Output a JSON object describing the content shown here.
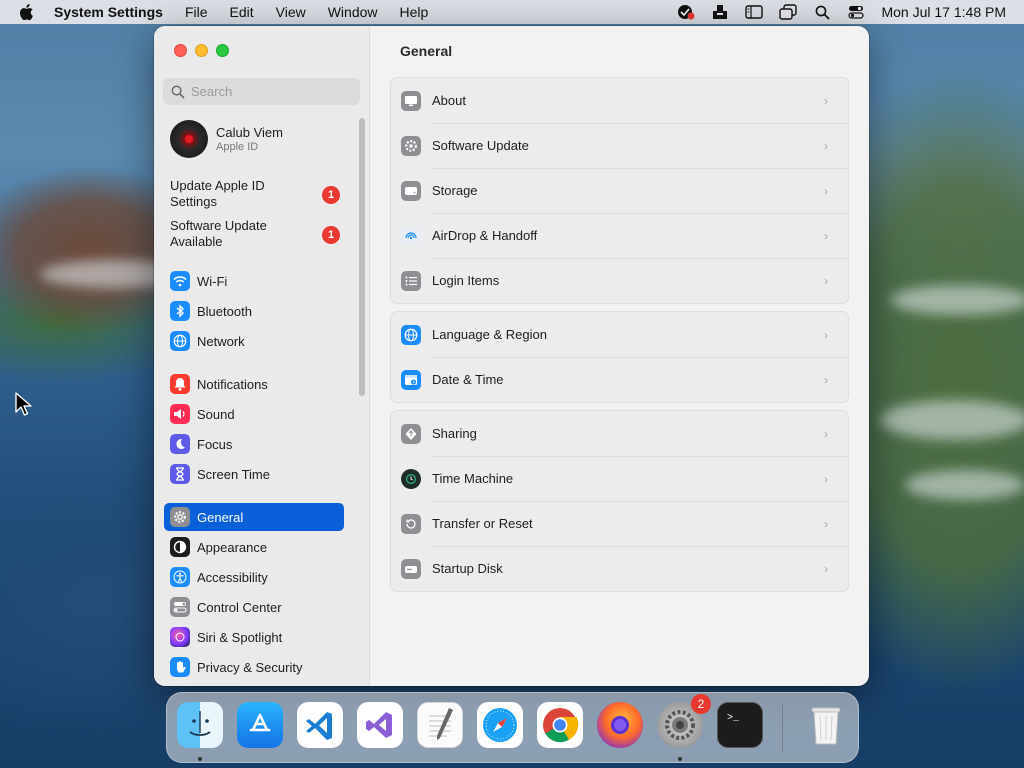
{
  "menubar": {
    "app_name": "System Settings",
    "menus": [
      "File",
      "Edit",
      "View",
      "Window",
      "Help"
    ],
    "status_icons": [
      "security-icon",
      "inbox-tray-icon",
      "sidebar-list-icon",
      "window-stack-icon",
      "search-icon",
      "control-center-icon"
    ],
    "clock": "Mon Jul 17  1:48 PM"
  },
  "window": {
    "sidebar": {
      "search_placeholder": "Search",
      "account": {
        "name": "Calub Viem",
        "subtitle": "Apple ID"
      },
      "notices": [
        {
          "label": "Update Apple ID Settings",
          "badge": "1"
        },
        {
          "label": "Software Update Available",
          "badge": "1"
        }
      ],
      "items": [
        {
          "label": "Wi-Fi",
          "icon": "wifi-icon",
          "color": "#1a8cff"
        },
        {
          "label": "Bluetooth",
          "icon": "bluetooth-icon",
          "color": "#1a8cff"
        },
        {
          "label": "Network",
          "icon": "globe-icon",
          "color": "#1a8cff"
        },
        {
          "label": "Notifications",
          "icon": "bell-icon",
          "color": "#ff3b30"
        },
        {
          "label": "Sound",
          "icon": "speaker-icon",
          "color": "#ff2d55"
        },
        {
          "label": "Focus",
          "icon": "moon-icon",
          "color": "#5e5ce6"
        },
        {
          "label": "Screen Time",
          "icon": "hourglass-icon",
          "color": "#5e5ce6"
        },
        {
          "label": "General",
          "icon": "gear-icon",
          "color": "#8e8e93",
          "active": true
        },
        {
          "label": "Appearance",
          "icon": "appearance-icon",
          "color": "#1c1c1e"
        },
        {
          "label": "Accessibility",
          "icon": "accessibility-icon",
          "color": "#1a8cff"
        },
        {
          "label": "Control Center",
          "icon": "toggles-icon",
          "color": "#8e8e93"
        },
        {
          "label": "Siri & Spotlight",
          "icon": "siri-icon",
          "color": "#bf5af2"
        },
        {
          "label": "Privacy & Security",
          "icon": "hand-icon",
          "color": "#1a8cff"
        }
      ]
    },
    "main": {
      "title": "General",
      "groups": [
        [
          {
            "label": "About",
            "icon": "computer-icon"
          },
          {
            "label": "Software Update",
            "icon": "gear-badge-icon"
          },
          {
            "label": "Storage",
            "icon": "disk-icon"
          },
          {
            "label": "AirDrop & Handoff",
            "icon": "airdrop-icon"
          },
          {
            "label": "Login Items",
            "icon": "list-icon"
          }
        ],
        [
          {
            "label": "Language & Region",
            "icon": "globe-icon"
          },
          {
            "label": "Date & Time",
            "icon": "calendar-clock-icon"
          }
        ],
        [
          {
            "label": "Sharing",
            "icon": "sharing-icon"
          },
          {
            "label": "Time Machine",
            "icon": "time-machine-icon"
          },
          {
            "label": "Transfer or Reset",
            "icon": "reset-icon"
          },
          {
            "label": "Startup Disk",
            "icon": "startup-disk-icon"
          }
        ]
      ]
    }
  },
  "dock": {
    "apps": [
      {
        "name": "Finder",
        "icon": "finder-icon",
        "running": true
      },
      {
        "name": "App Store",
        "icon": "app-store-icon"
      },
      {
        "name": "Visual Studio Code",
        "icon": "vscode-icon"
      },
      {
        "name": "Visual Studio",
        "icon": "visual-studio-icon"
      },
      {
        "name": "TextEdit",
        "icon": "textedit-icon"
      },
      {
        "name": "Safari",
        "icon": "safari-icon"
      },
      {
        "name": "Chrome",
        "icon": "chrome-icon"
      },
      {
        "name": "Firefox",
        "icon": "firefox-icon"
      },
      {
        "name": "System Settings",
        "icon": "system-settings-icon",
        "running": true,
        "badge": "2"
      },
      {
        "name": "Terminal",
        "icon": "terminal-icon"
      },
      {
        "name": "Trash",
        "icon": "trash-icon"
      }
    ]
  }
}
